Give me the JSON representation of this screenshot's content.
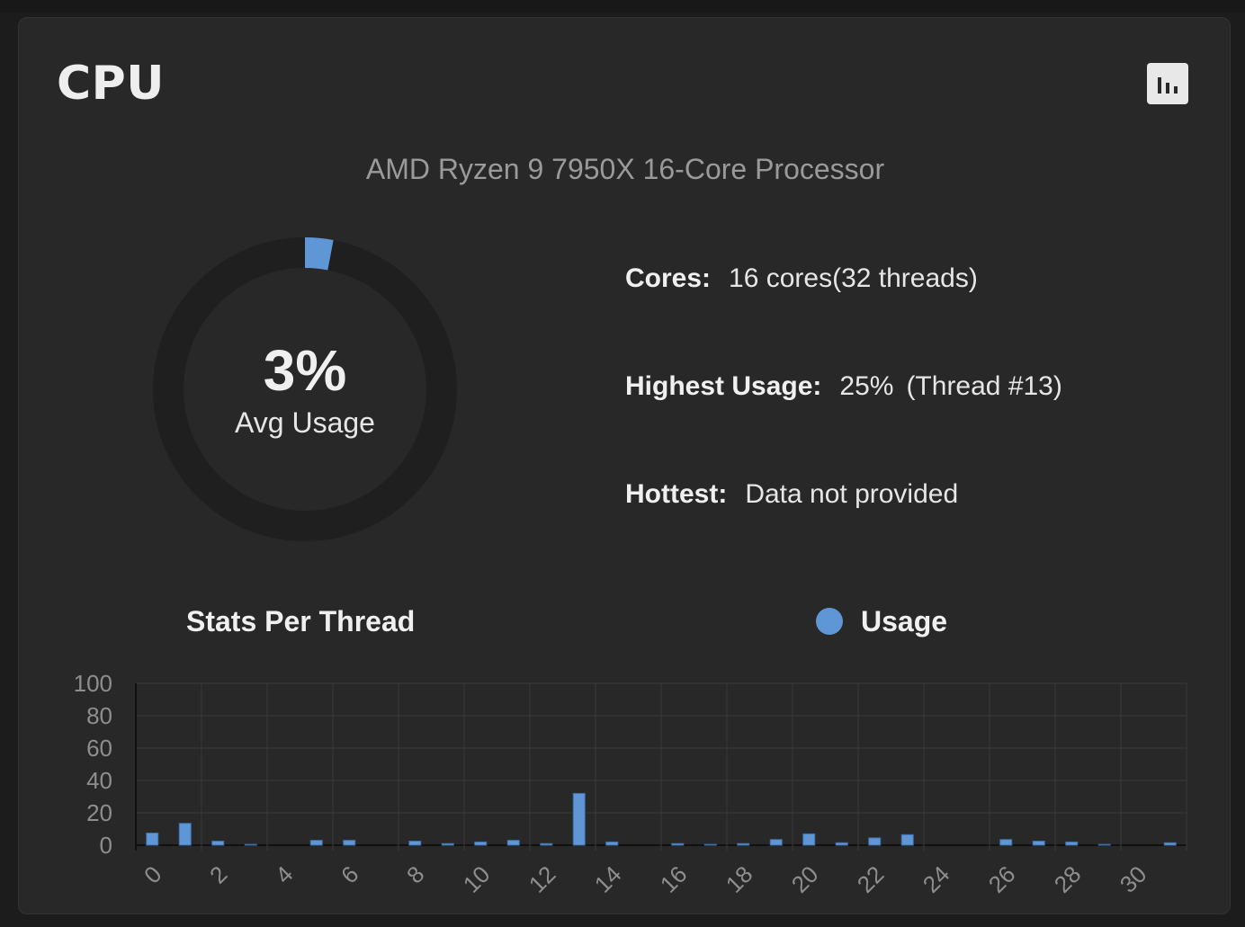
{
  "card": {
    "title": "CPU",
    "chart_toggle_icon": "bar-chart-icon",
    "model": "AMD Ryzen 9 7950X 16-Core Processor"
  },
  "gauge": {
    "value_text": "3%",
    "label": "Avg Usage",
    "fraction": 0.03
  },
  "info": {
    "cores_label": "Cores:",
    "cores_value": "16 cores(32 threads)",
    "highest_label": "Highest Usage:",
    "highest_value": "25%",
    "highest_thread": "(Thread #13)",
    "hottest_label": "Hottest:",
    "hottest_value": "Data not provided"
  },
  "stats": {
    "title": "Stats Per Thread"
  },
  "colors": {
    "accent": "#5f97d6",
    "card_bg": "#282828",
    "gauge_track": "#1f1f1f",
    "grid": "#3a3a3a",
    "tick_text": "#8e8e8e"
  },
  "chart_data": {
    "type": "bar",
    "categories": [
      "0",
      "1",
      "2",
      "3",
      "4",
      "5",
      "6",
      "7",
      "8",
      "9",
      "10",
      "11",
      "12",
      "13",
      "14",
      "15",
      "16",
      "17",
      "18",
      "19",
      "20",
      "21",
      "22",
      "23",
      "24",
      "25",
      "26",
      "27",
      "28",
      "29",
      "30",
      "31"
    ],
    "x_tick_labels": [
      "0",
      "2",
      "4",
      "6",
      "8",
      "10",
      "12",
      "14",
      "16",
      "18",
      "20",
      "22",
      "24",
      "26",
      "28",
      "30"
    ],
    "series": [
      {
        "name": "Usage",
        "values": [
          7.5,
          13.5,
          2.5,
          0.5,
          0,
          3,
          3,
          0,
          2.5,
          1,
          2,
          3,
          1,
          32,
          2,
          0,
          1,
          0.5,
          1,
          3.5,
          7,
          1.5,
          4.5,
          6.5,
          0,
          0,
          3.5,
          2.5,
          2,
          0.5,
          0,
          1.5
        ]
      }
    ],
    "ylim": [
      0,
      100
    ],
    "y_ticks": [
      0,
      20,
      40,
      60,
      80,
      100
    ],
    "grid": true,
    "legend_placement": "top"
  }
}
